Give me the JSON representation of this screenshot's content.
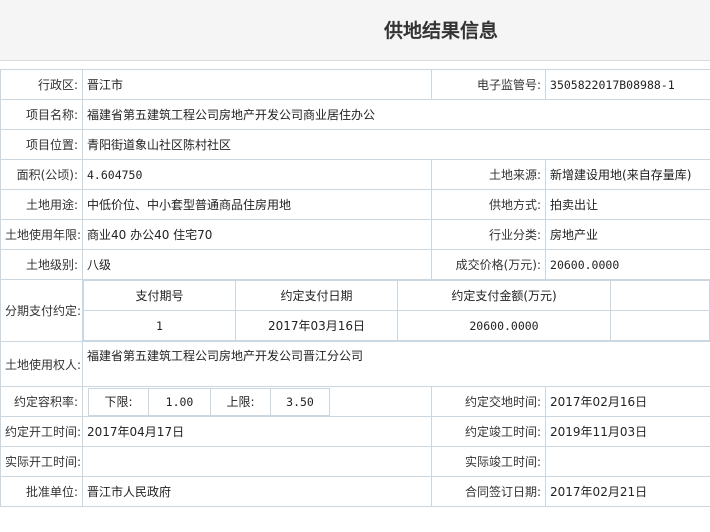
{
  "header": {
    "title": "供地结果信息"
  },
  "fields": {
    "district_label": "行政区:",
    "district": "晋江市",
    "supervision_label": "电子监管号:",
    "supervision": "3505822017B08988-1",
    "project_name_label": "项目名称:",
    "project_name": "福建省第五建筑工程公司房地产开发公司商业居住办公",
    "location_label": "项目位置:",
    "location": "青阳街道象山社区陈村社区",
    "area_label": "面积(公顷):",
    "area": "4.604750",
    "source_label": "土地来源:",
    "source": "新增建设用地(来自存量库)",
    "use_label": "土地用途:",
    "use": "中低价位、中小套型普通商品住房用地",
    "supply_label": "供地方式:",
    "supply": "拍卖出让",
    "term_label": "土地使用年限:",
    "term": "商业40 办公40 住宅70",
    "industry_label": "行业分类:",
    "industry": "房地产业",
    "level_label": "土地级别:",
    "level": "八级",
    "price_label": "成交价格(万元):",
    "price": "20600.0000",
    "installment_label": "分期支付约定:",
    "user_label": "土地使用权人:",
    "user": "福建省第五建筑工程公司房地产开发公司晋江分公司",
    "far_label": "约定容积率:",
    "far_low_label": "下限:",
    "far_low": "1.00",
    "far_high_label": "上限:",
    "far_high": "3.50",
    "handover_label": "约定交地时间:",
    "handover": "2017年02月16日",
    "start_label": "约定开工时间:",
    "start": "2017年04月17日",
    "complete_label": "约定竣工时间:",
    "complete": "2019年11月03日",
    "actual_start_label": "实际开工时间:",
    "actual_start": "",
    "actual_complete_label": "实际竣工时间:",
    "actual_complete": "",
    "approver_label": "批准单位:",
    "approver": "晋江市人民政府",
    "contract_label": "合同签订日期:",
    "contract": "2017年02月21日"
  },
  "installments": {
    "headers": [
      "支付期号",
      "约定支付日期",
      "约定支付金额(万元)",
      ""
    ],
    "rows": [
      [
        "1",
        "2017年03月16日",
        "20600.0000",
        ""
      ]
    ]
  }
}
